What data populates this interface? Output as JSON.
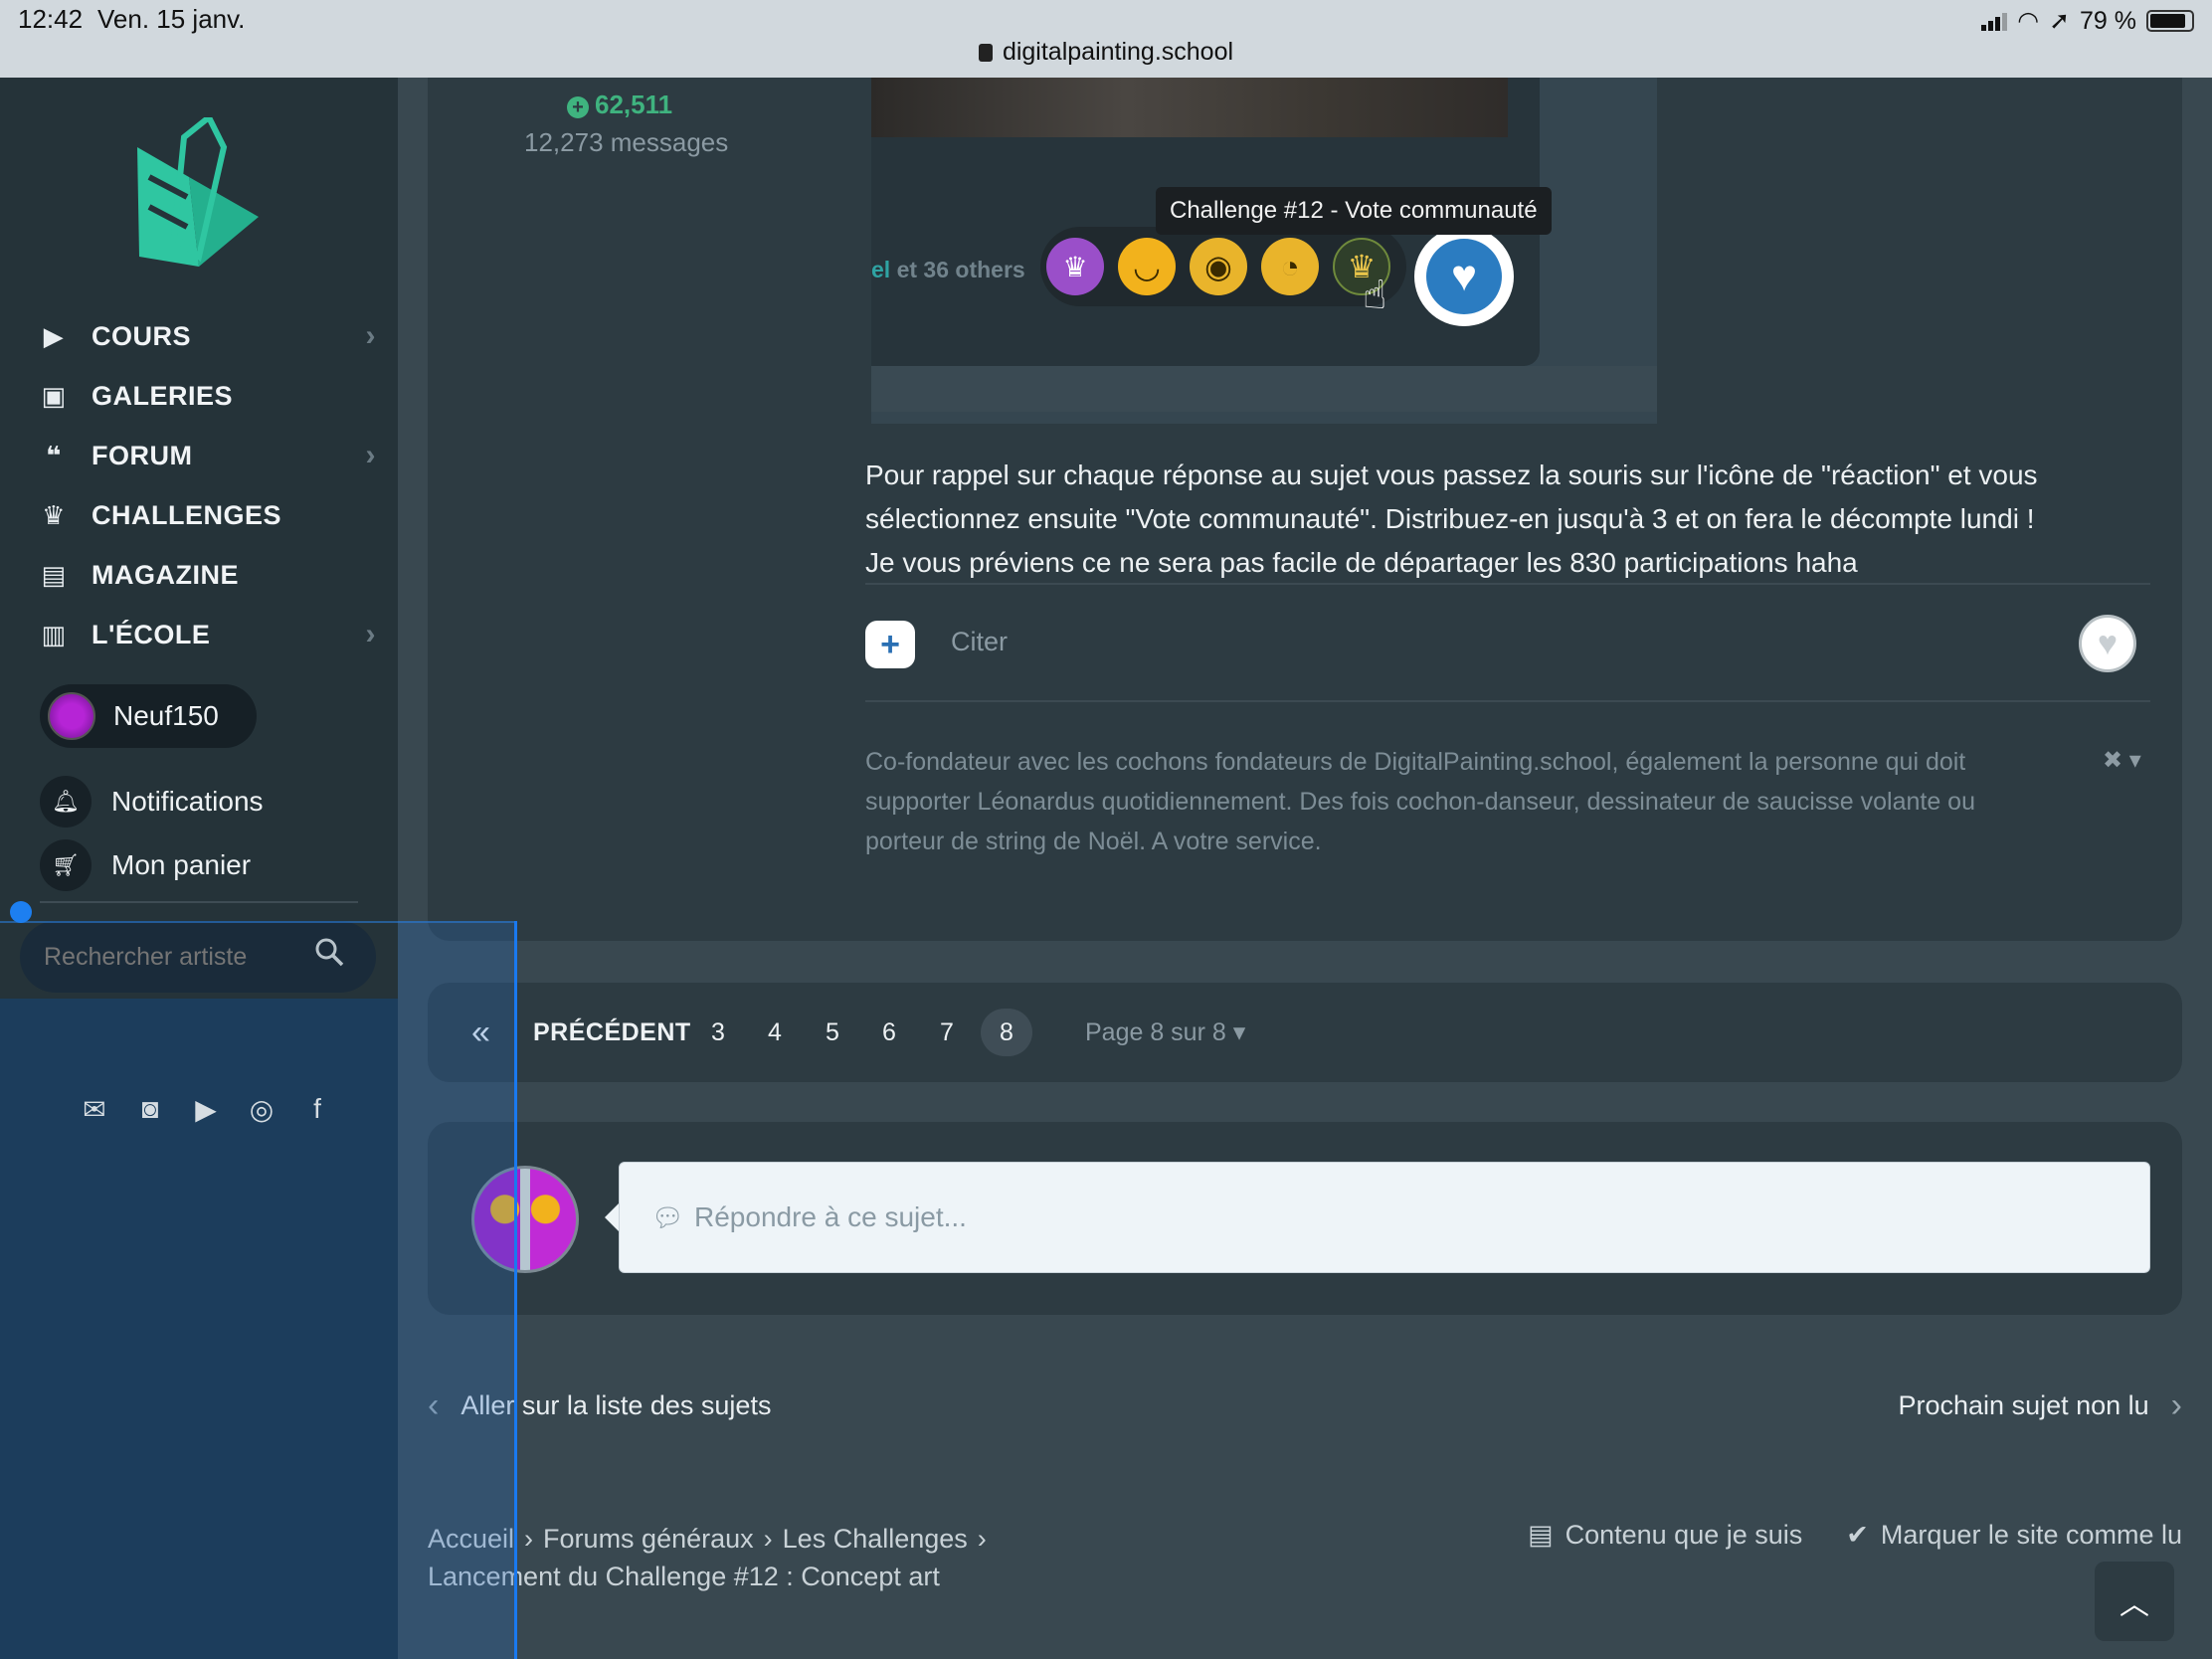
{
  "status_bar": {
    "time": "12:42",
    "date": "Ven. 15 janv.",
    "url": "digitalpainting.school",
    "battery": "79 %"
  },
  "sidebar": {
    "nav": [
      {
        "label": "COURS",
        "icon": "play-icon",
        "has_submenu": true
      },
      {
        "label": "GALERIES",
        "icon": "gallery-icon",
        "has_submenu": false
      },
      {
        "label": "FORUM",
        "icon": "chat-icon",
        "has_submenu": true
      },
      {
        "label": "CHALLENGES",
        "icon": "trophy-icon",
        "has_submenu": false
      },
      {
        "label": "MAGAZINE",
        "icon": "book-icon",
        "has_submenu": false
      },
      {
        "label": "L'ÉCOLE",
        "icon": "building-icon",
        "has_submenu": true
      }
    ],
    "user": {
      "name": "Neuf150"
    },
    "notifications_label": "Notifications",
    "cart_label": "Mon panier",
    "search_placeholder": "Rechercher artiste",
    "socials": [
      "mail-icon",
      "discord-icon",
      "youtube-icon",
      "instagram-icon",
      "facebook-icon"
    ]
  },
  "post": {
    "author_points": "62,511",
    "author_messages": "12,273 messages",
    "embed": {
      "others_name": "el",
      "others_text": "et 36 others",
      "tooltip": "Challenge #12 - Vote communauté",
      "reactions": [
        "trophy-reaction-icon",
        "laugh-reaction-icon",
        "confused-reaction-icon",
        "sad-reaction-icon",
        "award-reaction-icon"
      ]
    },
    "body": [
      "Pour rappel sur chaque réponse au sujet vous passez la souris sur l'icône de \"réaction\" et vous",
      "sélectionnez ensuite \"Vote communauté\". Distribuez-en jusqu'à 3 et on fera le décompte lundi !",
      "Je vous préviens ce ne sera pas facile de départager les 830 participations haha"
    ],
    "quote_label": "Citer",
    "signature": [
      "Co-fondateur avec les cochons fondateurs de DigitalPainting.school, également la personne qui doit",
      "supporter Léonardus quotidiennement. Des fois cochon-danseur, dessinateur de saucisse volante ou",
      "porteur de string de Noël. A votre service."
    ]
  },
  "pagination": {
    "prev_label": "PRÉCÉDENT",
    "pages": [
      "3",
      "4",
      "5",
      "6",
      "7"
    ],
    "current": "8",
    "jump_label": "Page 8 sur 8"
  },
  "reply": {
    "placeholder": "Répondre à ce sujet..."
  },
  "topic_nav": {
    "back_label": "Aller sur la liste des sujets",
    "next_label": "Prochain sujet non lu"
  },
  "breadcrumb": {
    "items": [
      "Accueil",
      "Forums généraux",
      "Les Challenges"
    ],
    "current": "Lancement du Challenge #12 : Concept art"
  },
  "footer_actions": {
    "followed": "Contenu que je suis",
    "mark_read": "Marquer le site comme lu"
  },
  "colors": {
    "accent_blue": "#1979f0",
    "points_green": "#3fb37f",
    "sidebar_bg": "#253339",
    "panel_bg": "#2d3b42"
  }
}
